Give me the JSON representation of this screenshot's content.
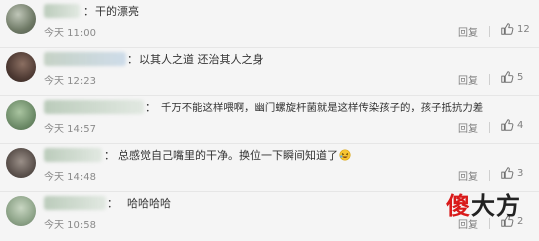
{
  "comments": [
    {
      "name_suffix": "：",
      "text": "干的漂亮",
      "time": "今天 11:00",
      "reply": "回复",
      "likes": "12"
    },
    {
      "name_suffix": "：",
      "text": "以其人之道 还治其人之身",
      "time": "今天 12:23",
      "reply": "回复",
      "likes": "5"
    },
    {
      "name_suffix": "：",
      "text": "千万不能这样喂啊，幽门螺旋杆菌就是这样传染孩子的，孩子抵抗力差",
      "time": "今天 14:57",
      "reply": "回复",
      "likes": "4"
    },
    {
      "name_suffix": "：",
      "text": "总感觉自己嘴里的干净。换位一下瞬间知道了",
      "time": "今天 14:48",
      "reply": "回复",
      "likes": "3"
    },
    {
      "name_suffix": "：",
      "text": "哈哈哈哈",
      "time": "今天 10:58",
      "reply": "回复",
      "likes": "2"
    }
  ],
  "watermark": {
    "char1": "傻",
    "char2": "大方"
  },
  "icons": {
    "like": "thumbs-up-icon",
    "emoji": "laughing-emoji-icon"
  },
  "colors": {
    "brand_red": "#d91a1a",
    "text": "#333333",
    "meta": "#8a8a8a",
    "background": "#f5f5f5"
  }
}
